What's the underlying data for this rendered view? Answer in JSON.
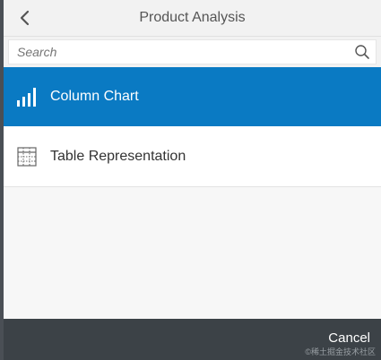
{
  "header": {
    "title": "Product Analysis",
    "back_icon": "chevron-left-icon"
  },
  "search": {
    "placeholder": "Search",
    "value": "",
    "icon": "search-icon"
  },
  "items": [
    {
      "label": "Column Chart",
      "icon": "column-chart-icon",
      "selected": true
    },
    {
      "label": "Table Representation",
      "icon": "table-icon",
      "selected": false
    }
  ],
  "footer": {
    "cancel_label": "Cancel",
    "watermark": "©稀土掘金技术社区"
  },
  "colors": {
    "selected_bg": "#0a7ac3",
    "footer_bg": "#3c4247",
    "header_bg": "#f2f2f2"
  }
}
